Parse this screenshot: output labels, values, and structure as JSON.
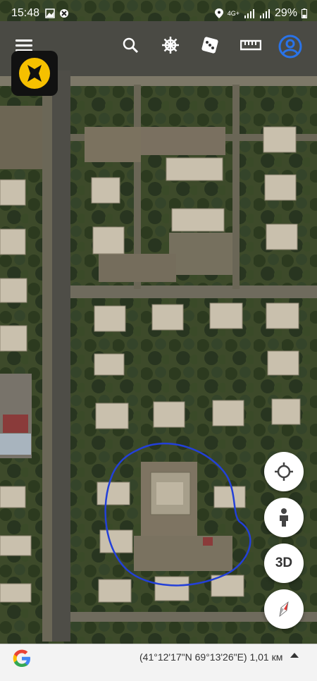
{
  "status": {
    "time": "15:48",
    "network": "4G+",
    "battery": "29%"
  },
  "toolbar": {
    "menu_icon": "hamburger-menu-icon",
    "search_icon": "search-icon",
    "helm_icon": "ship-wheel-icon",
    "dice_icon": "dice-icon",
    "ruler_icon": "ruler-icon",
    "account_icon": "account-icon"
  },
  "map_controls": {
    "locate_icon": "crosshair-icon",
    "street_view_icon": "person-icon",
    "three_d_label": "3D",
    "compass_icon": "compass-icon"
  },
  "bottom_bar": {
    "coordinates": "(41°12'17\"N 69°13'26\"E) 1,01 км"
  },
  "colors": {
    "accent": "#2a73e8",
    "app_icon_yellow": "#f6c000",
    "annotation_stroke": "#2340d8",
    "compass_red": "#e53935"
  }
}
